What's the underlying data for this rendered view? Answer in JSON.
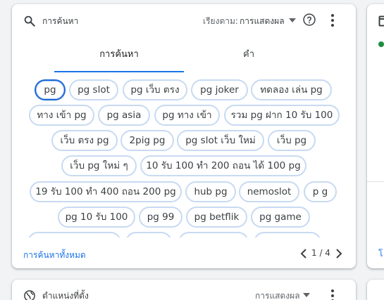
{
  "search_card": {
    "title": "การค้นหา",
    "sort_label": "เรียงตาม:",
    "sort_value": "การแสดงผล",
    "tabs": [
      {
        "label": "การค้นหา",
        "selected": true
      },
      {
        "label": "คำ",
        "selected": false
      }
    ],
    "chips": [
      "pg",
      "pg slot",
      "pg เว็บ ตรง",
      "pg joker",
      "ทดลอง เล่น pg",
      "ทาง เข้า pg",
      "pg asia",
      "pg ทาง เข้า",
      "รวม pg ฝาก 10 รับ 100",
      "เว็บ ตรง pg",
      "2pig pg",
      "pg slot เว็บ ใหม่",
      "เว็บ pg",
      "เว็บ pg ใหม่ ๆ",
      "10 รับ 100 ทำ 200 ถอน ได้ 100 pg",
      "19 รับ 100 ทำ 400 ถอน 200 pg",
      "hub pg",
      "nemoslot",
      "p g",
      "pg 10 รับ 100",
      "pg 99",
      "pg betflik",
      "pg game",
      "",
      "",
      "",
      ""
    ],
    "selected_chip": "pg",
    "footer_link": "การค้นหาทั้งหมด",
    "pager": "1 / 4"
  },
  "right_card": {
    "link_fragment": "โ"
  },
  "location_card": {
    "title": "ตำแหน่งที่ตั้ง",
    "sort_value": "การแสดงผล"
  },
  "colors": {
    "accent": "#1a73e8",
    "chip_border": "#c7daf2",
    "selected_border": "#1967d2",
    "status_dot": "#1e8e3e"
  }
}
